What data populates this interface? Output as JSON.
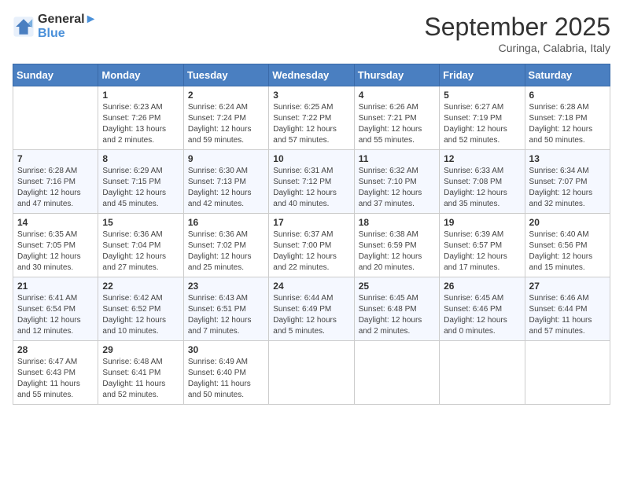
{
  "header": {
    "logo_line1": "General",
    "logo_line2": "Blue",
    "month_title": "September 2025",
    "location": "Curinga, Calabria, Italy"
  },
  "weekdays": [
    "Sunday",
    "Monday",
    "Tuesday",
    "Wednesday",
    "Thursday",
    "Friday",
    "Saturday"
  ],
  "weeks": [
    [
      {
        "day": "",
        "info": ""
      },
      {
        "day": "1",
        "info": "Sunrise: 6:23 AM\nSunset: 7:26 PM\nDaylight: 13 hours\nand 2 minutes."
      },
      {
        "day": "2",
        "info": "Sunrise: 6:24 AM\nSunset: 7:24 PM\nDaylight: 12 hours\nand 59 minutes."
      },
      {
        "day": "3",
        "info": "Sunrise: 6:25 AM\nSunset: 7:22 PM\nDaylight: 12 hours\nand 57 minutes."
      },
      {
        "day": "4",
        "info": "Sunrise: 6:26 AM\nSunset: 7:21 PM\nDaylight: 12 hours\nand 55 minutes."
      },
      {
        "day": "5",
        "info": "Sunrise: 6:27 AM\nSunset: 7:19 PM\nDaylight: 12 hours\nand 52 minutes."
      },
      {
        "day": "6",
        "info": "Sunrise: 6:28 AM\nSunset: 7:18 PM\nDaylight: 12 hours\nand 50 minutes."
      }
    ],
    [
      {
        "day": "7",
        "info": "Sunrise: 6:28 AM\nSunset: 7:16 PM\nDaylight: 12 hours\nand 47 minutes."
      },
      {
        "day": "8",
        "info": "Sunrise: 6:29 AM\nSunset: 7:15 PM\nDaylight: 12 hours\nand 45 minutes."
      },
      {
        "day": "9",
        "info": "Sunrise: 6:30 AM\nSunset: 7:13 PM\nDaylight: 12 hours\nand 42 minutes."
      },
      {
        "day": "10",
        "info": "Sunrise: 6:31 AM\nSunset: 7:12 PM\nDaylight: 12 hours\nand 40 minutes."
      },
      {
        "day": "11",
        "info": "Sunrise: 6:32 AM\nSunset: 7:10 PM\nDaylight: 12 hours\nand 37 minutes."
      },
      {
        "day": "12",
        "info": "Sunrise: 6:33 AM\nSunset: 7:08 PM\nDaylight: 12 hours\nand 35 minutes."
      },
      {
        "day": "13",
        "info": "Sunrise: 6:34 AM\nSunset: 7:07 PM\nDaylight: 12 hours\nand 32 minutes."
      }
    ],
    [
      {
        "day": "14",
        "info": "Sunrise: 6:35 AM\nSunset: 7:05 PM\nDaylight: 12 hours\nand 30 minutes."
      },
      {
        "day": "15",
        "info": "Sunrise: 6:36 AM\nSunset: 7:04 PM\nDaylight: 12 hours\nand 27 minutes."
      },
      {
        "day": "16",
        "info": "Sunrise: 6:36 AM\nSunset: 7:02 PM\nDaylight: 12 hours\nand 25 minutes."
      },
      {
        "day": "17",
        "info": "Sunrise: 6:37 AM\nSunset: 7:00 PM\nDaylight: 12 hours\nand 22 minutes."
      },
      {
        "day": "18",
        "info": "Sunrise: 6:38 AM\nSunset: 6:59 PM\nDaylight: 12 hours\nand 20 minutes."
      },
      {
        "day": "19",
        "info": "Sunrise: 6:39 AM\nSunset: 6:57 PM\nDaylight: 12 hours\nand 17 minutes."
      },
      {
        "day": "20",
        "info": "Sunrise: 6:40 AM\nSunset: 6:56 PM\nDaylight: 12 hours\nand 15 minutes."
      }
    ],
    [
      {
        "day": "21",
        "info": "Sunrise: 6:41 AM\nSunset: 6:54 PM\nDaylight: 12 hours\nand 12 minutes."
      },
      {
        "day": "22",
        "info": "Sunrise: 6:42 AM\nSunset: 6:52 PM\nDaylight: 12 hours\nand 10 minutes."
      },
      {
        "day": "23",
        "info": "Sunrise: 6:43 AM\nSunset: 6:51 PM\nDaylight: 12 hours\nand 7 minutes."
      },
      {
        "day": "24",
        "info": "Sunrise: 6:44 AM\nSunset: 6:49 PM\nDaylight: 12 hours\nand 5 minutes."
      },
      {
        "day": "25",
        "info": "Sunrise: 6:45 AM\nSunset: 6:48 PM\nDaylight: 12 hours\nand 2 minutes."
      },
      {
        "day": "26",
        "info": "Sunrise: 6:45 AM\nSunset: 6:46 PM\nDaylight: 12 hours\nand 0 minutes."
      },
      {
        "day": "27",
        "info": "Sunrise: 6:46 AM\nSunset: 6:44 PM\nDaylight: 11 hours\nand 57 minutes."
      }
    ],
    [
      {
        "day": "28",
        "info": "Sunrise: 6:47 AM\nSunset: 6:43 PM\nDaylight: 11 hours\nand 55 minutes."
      },
      {
        "day": "29",
        "info": "Sunrise: 6:48 AM\nSunset: 6:41 PM\nDaylight: 11 hours\nand 52 minutes."
      },
      {
        "day": "30",
        "info": "Sunrise: 6:49 AM\nSunset: 6:40 PM\nDaylight: 11 hours\nand 50 minutes."
      },
      {
        "day": "",
        "info": ""
      },
      {
        "day": "",
        "info": ""
      },
      {
        "day": "",
        "info": ""
      },
      {
        "day": "",
        "info": ""
      }
    ]
  ]
}
